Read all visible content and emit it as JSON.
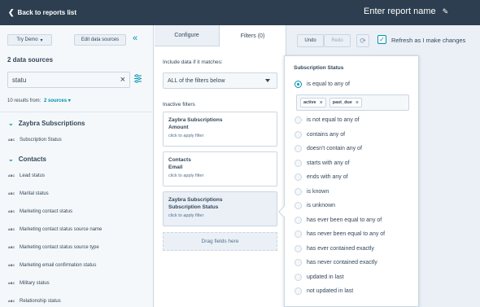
{
  "topbar": {
    "back_label": "Back to reports list",
    "report_name": "Enter report name"
  },
  "left": {
    "try_demo_label": "Try Demo",
    "edit_data_sources_label": "Edit data sources",
    "data_sources_title": "2 data sources",
    "search_value": "statu",
    "results_prefix": "10 results from:",
    "results_link": "2 sources",
    "groups": [
      {
        "name": "Zaybra Subscriptions",
        "items": [
          "Subscription Status"
        ]
      },
      {
        "name": "Contacts",
        "items": [
          "Lead status",
          "Marital status",
          "Marketing contact status",
          "Marketing contact status source name",
          "Marketing contact status source type",
          "Marketing email confirmation status",
          "Military status",
          "Relationship status"
        ]
      }
    ],
    "type_badge": "ABC"
  },
  "middle": {
    "tabs": [
      "Configure",
      "Filters (0)"
    ],
    "include_label": "Include data if it matches:",
    "match_select": "ALL of the filters below",
    "inactive_label": "Inactive filters",
    "filters": [
      {
        "source": "Zaybra Subscriptions",
        "property": "Amount",
        "hint": "click to apply filter"
      },
      {
        "source": "Contacts",
        "property": "Email",
        "hint": "click to apply filter"
      },
      {
        "source": "Zaybra Subscriptions",
        "property": "Subscription Status",
        "hint": "click to apply filter"
      }
    ],
    "drag_label": "Drag fields here"
  },
  "right": {
    "undo_label": "Undo",
    "redo_label": "Redo",
    "refresh_label": "Refresh as I make changes",
    "refresh_checked": true
  },
  "popover": {
    "title": "Subscription Status",
    "selected_option": "is equal to any of",
    "tags": [
      "active",
      "past_due"
    ],
    "options": [
      "is not equal to any of",
      "contains any of",
      "doesn't contain any of",
      "starts with any of",
      "ends with any of",
      "is known",
      "is unknown",
      "has ever been equal to any of",
      "has never been equal to any of",
      "has ever contained exactly",
      "has never contained exactly",
      "updated in last",
      "not updated in last"
    ]
  },
  "colors": {
    "topbar": "#2d3e50",
    "accent": "#0091ae",
    "text": "#33475b",
    "panel": "#f5f8fa"
  }
}
